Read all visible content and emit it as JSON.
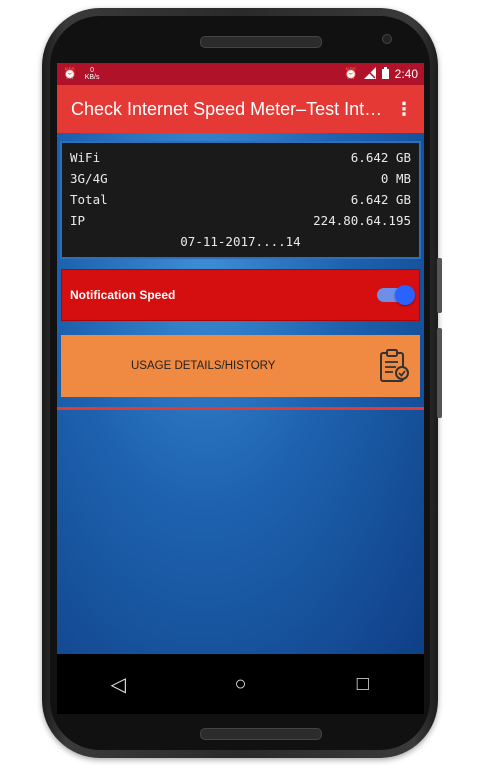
{
  "statusbar": {
    "left_icons": [
      "alarm-icon",
      "network-speed-icon"
    ],
    "netspeed_text": "KB/s",
    "right_icons": [
      "alarm-icon",
      "signal-icon",
      "battery-icon"
    ],
    "time": "2:40"
  },
  "appbar": {
    "title": "Check Internet Speed Meter–Test Int…",
    "menu_icon": "overflow-menu-icon"
  },
  "stats": {
    "rows": [
      {
        "label": "WiFi",
        "value": "6.642 GB"
      },
      {
        "label": "3G/4G",
        "value": "0 MB"
      },
      {
        "label": "Total",
        "value": "6.642 GB"
      },
      {
        "label": "IP",
        "value": "224.80.64.195"
      }
    ],
    "date": "07-11-2017....14"
  },
  "notification": {
    "label": "Notification Speed",
    "enabled": true
  },
  "usage": {
    "label": "USAGE DETAILS/HISTORY",
    "icon": "clipboard-check-icon"
  },
  "navbar": {
    "back": "◁",
    "home": "○",
    "recents": "□"
  },
  "colors": {
    "statusbar": "#b0122a",
    "appbar": "#e53935",
    "notification": "#d50f0f",
    "usage": "#f08a43",
    "background": "#1e63b0"
  }
}
